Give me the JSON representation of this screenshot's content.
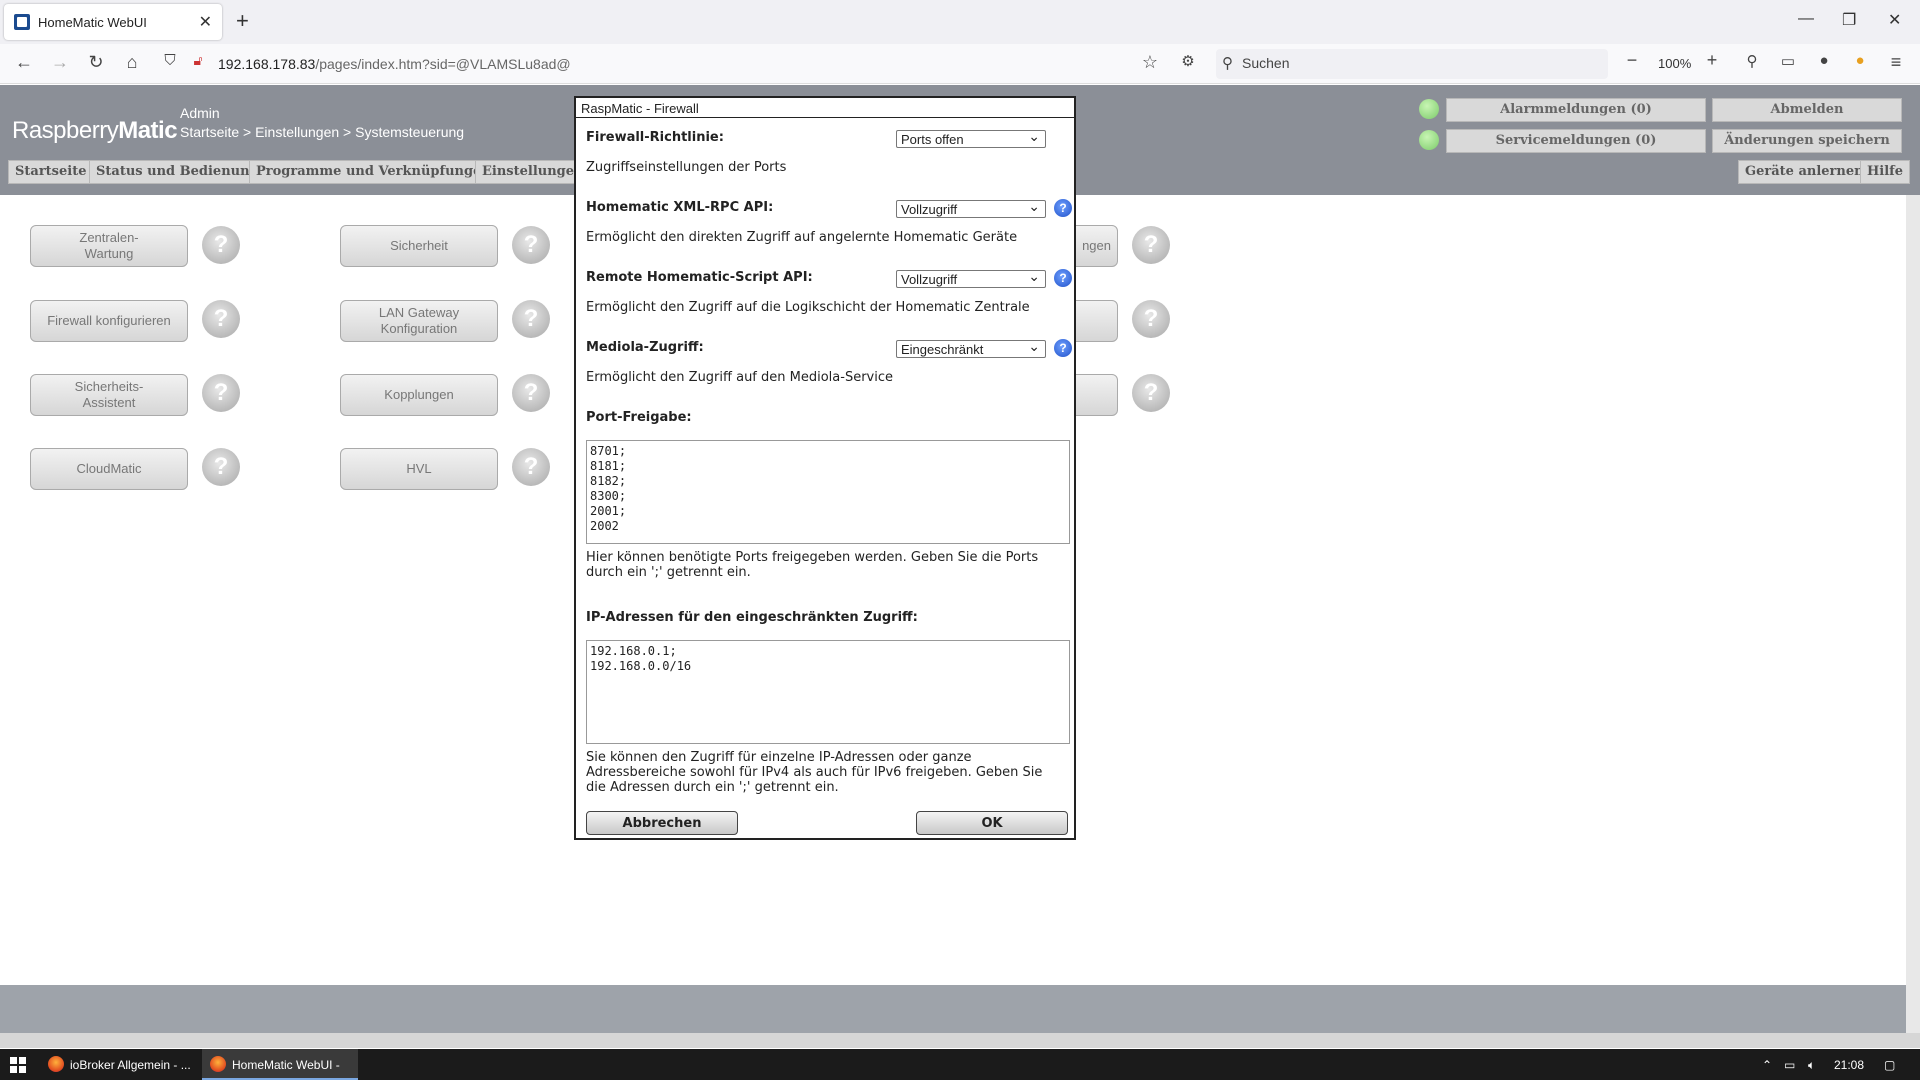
{
  "browser": {
    "tab_title": "HomeMatic WebUI",
    "url_host": "192.168.178.83",
    "url_path": "/pages/index.htm?sid=@VLAMSLu8ad@",
    "search_placeholder": "Suchen",
    "zoom": "100%"
  },
  "header": {
    "logo_a": "Raspberry",
    "logo_b": "Matic",
    "user": "Admin",
    "breadcrumb": "Startseite > Einstellungen > Systemsteuerung",
    "alarm_label": "Alarmmeldungen (0)",
    "service_label": "Servicemeldungen (0)",
    "logout_label": "Abmelden",
    "save_label": "Änderungen speichern",
    "learn_label": "Geräte anlernen",
    "help_label": "Hilfe",
    "menu": [
      "Startseite",
      "Status und Bedienung",
      "Programme und Verknüpfungen",
      "Einstellungen"
    ]
  },
  "tiles": {
    "col1": [
      "Zentralen-\nWartung",
      "Firewall konfigurieren",
      "Sicherheits-\nAssistent",
      "CloudMatic"
    ],
    "col2": [
      "Sicherheit",
      "LAN Gateway\nKonfiguration",
      "Kopplungen",
      "HVL"
    ],
    "col3_partial": "ngen"
  },
  "dialog": {
    "title": "RaspMatic - Firewall",
    "policy_label": "Firewall-Richtlinie:",
    "policy_value": "Ports offen",
    "policy_desc": "Zugriffseinstellungen der Ports",
    "xmlrpc_label": "Homematic XML-RPC API:",
    "xmlrpc_value": "Vollzugriff",
    "xmlrpc_desc": "Ermöglicht den direkten Zugriff auf angelernte Homematic Geräte",
    "script_label": "Remote Homematic-Script API:",
    "script_value": "Vollzugriff",
    "script_desc": "Ermöglicht den Zugriff auf die Logikschicht der Homematic Zentrale",
    "mediola_label": "Mediola-Zugriff:",
    "mediola_value": "Eingeschränkt",
    "mediola_desc": "Ermöglicht den Zugriff auf den Mediola-Service",
    "ports_label": "Port-Freigabe:",
    "ports_value": "8701;\n8181;\n8182;\n8300;\n2001;\n2002",
    "ports_desc": "Hier können benötigte Ports freigegeben werden. Geben Sie die Ports durch ein ';' getrennt ein.",
    "ip_label": "IP-Adressen für den eingeschränkten Zugriff:",
    "ip_value": "192.168.0.1;\n192.168.0.0/16",
    "ip_desc": "Sie können den Zugriff für einzelne IP-Adressen oder ganze Adressbereiche sowohl für IPv4 als auch für IPv6 freigeben. Geben Sie die Adressen durch ein ';' getrennt ein.",
    "cancel_label": "Abbrechen",
    "ok_label": "OK"
  },
  "taskbar": {
    "task1": "ioBroker Allgemein - ...",
    "task2": "HomeMatic WebUI - ...",
    "clock": "21:08"
  }
}
